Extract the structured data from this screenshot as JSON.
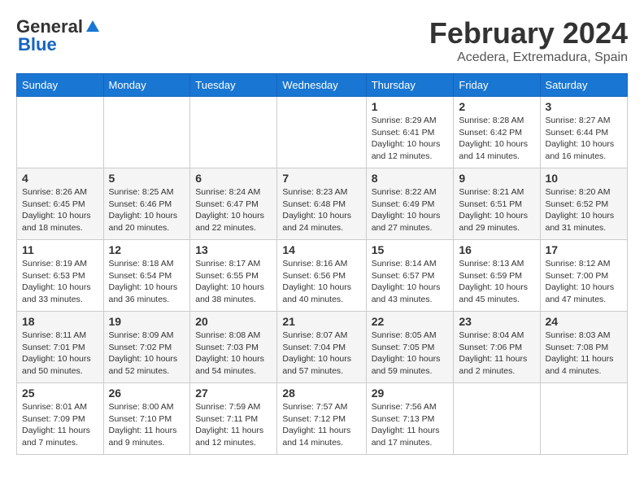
{
  "logo": {
    "text1": "General",
    "text2": "Blue"
  },
  "title": {
    "month_year": "February 2024",
    "location": "Acedera, Extremadura, Spain"
  },
  "columns": [
    "Sunday",
    "Monday",
    "Tuesday",
    "Wednesday",
    "Thursday",
    "Friday",
    "Saturday"
  ],
  "weeks": [
    [
      {
        "day": "",
        "info": ""
      },
      {
        "day": "",
        "info": ""
      },
      {
        "day": "",
        "info": ""
      },
      {
        "day": "",
        "info": ""
      },
      {
        "day": "1",
        "info": "Sunrise: 8:29 AM\nSunset: 6:41 PM\nDaylight: 10 hours\nand 12 minutes."
      },
      {
        "day": "2",
        "info": "Sunrise: 8:28 AM\nSunset: 6:42 PM\nDaylight: 10 hours\nand 14 minutes."
      },
      {
        "day": "3",
        "info": "Sunrise: 8:27 AM\nSunset: 6:44 PM\nDaylight: 10 hours\nand 16 minutes."
      }
    ],
    [
      {
        "day": "4",
        "info": "Sunrise: 8:26 AM\nSunset: 6:45 PM\nDaylight: 10 hours\nand 18 minutes."
      },
      {
        "day": "5",
        "info": "Sunrise: 8:25 AM\nSunset: 6:46 PM\nDaylight: 10 hours\nand 20 minutes."
      },
      {
        "day": "6",
        "info": "Sunrise: 8:24 AM\nSunset: 6:47 PM\nDaylight: 10 hours\nand 22 minutes."
      },
      {
        "day": "7",
        "info": "Sunrise: 8:23 AM\nSunset: 6:48 PM\nDaylight: 10 hours\nand 24 minutes."
      },
      {
        "day": "8",
        "info": "Sunrise: 8:22 AM\nSunset: 6:49 PM\nDaylight: 10 hours\nand 27 minutes."
      },
      {
        "day": "9",
        "info": "Sunrise: 8:21 AM\nSunset: 6:51 PM\nDaylight: 10 hours\nand 29 minutes."
      },
      {
        "day": "10",
        "info": "Sunrise: 8:20 AM\nSunset: 6:52 PM\nDaylight: 10 hours\nand 31 minutes."
      }
    ],
    [
      {
        "day": "11",
        "info": "Sunrise: 8:19 AM\nSunset: 6:53 PM\nDaylight: 10 hours\nand 33 minutes."
      },
      {
        "day": "12",
        "info": "Sunrise: 8:18 AM\nSunset: 6:54 PM\nDaylight: 10 hours\nand 36 minutes."
      },
      {
        "day": "13",
        "info": "Sunrise: 8:17 AM\nSunset: 6:55 PM\nDaylight: 10 hours\nand 38 minutes."
      },
      {
        "day": "14",
        "info": "Sunrise: 8:16 AM\nSunset: 6:56 PM\nDaylight: 10 hours\nand 40 minutes."
      },
      {
        "day": "15",
        "info": "Sunrise: 8:14 AM\nSunset: 6:57 PM\nDaylight: 10 hours\nand 43 minutes."
      },
      {
        "day": "16",
        "info": "Sunrise: 8:13 AM\nSunset: 6:59 PM\nDaylight: 10 hours\nand 45 minutes."
      },
      {
        "day": "17",
        "info": "Sunrise: 8:12 AM\nSunset: 7:00 PM\nDaylight: 10 hours\nand 47 minutes."
      }
    ],
    [
      {
        "day": "18",
        "info": "Sunrise: 8:11 AM\nSunset: 7:01 PM\nDaylight: 10 hours\nand 50 minutes."
      },
      {
        "day": "19",
        "info": "Sunrise: 8:09 AM\nSunset: 7:02 PM\nDaylight: 10 hours\nand 52 minutes."
      },
      {
        "day": "20",
        "info": "Sunrise: 8:08 AM\nSunset: 7:03 PM\nDaylight: 10 hours\nand 54 minutes."
      },
      {
        "day": "21",
        "info": "Sunrise: 8:07 AM\nSunset: 7:04 PM\nDaylight: 10 hours\nand 57 minutes."
      },
      {
        "day": "22",
        "info": "Sunrise: 8:05 AM\nSunset: 7:05 PM\nDaylight: 10 hours\nand 59 minutes."
      },
      {
        "day": "23",
        "info": "Sunrise: 8:04 AM\nSunset: 7:06 PM\nDaylight: 11 hours\nand 2 minutes."
      },
      {
        "day": "24",
        "info": "Sunrise: 8:03 AM\nSunset: 7:08 PM\nDaylight: 11 hours\nand 4 minutes."
      }
    ],
    [
      {
        "day": "25",
        "info": "Sunrise: 8:01 AM\nSunset: 7:09 PM\nDaylight: 11 hours\nand 7 minutes."
      },
      {
        "day": "26",
        "info": "Sunrise: 8:00 AM\nSunset: 7:10 PM\nDaylight: 11 hours\nand 9 minutes."
      },
      {
        "day": "27",
        "info": "Sunrise: 7:59 AM\nSunset: 7:11 PM\nDaylight: 11 hours\nand 12 minutes."
      },
      {
        "day": "28",
        "info": "Sunrise: 7:57 AM\nSunset: 7:12 PM\nDaylight: 11 hours\nand 14 minutes."
      },
      {
        "day": "29",
        "info": "Sunrise: 7:56 AM\nSunset: 7:13 PM\nDaylight: 11 hours\nand 17 minutes."
      },
      {
        "day": "",
        "info": ""
      },
      {
        "day": "",
        "info": ""
      }
    ]
  ]
}
